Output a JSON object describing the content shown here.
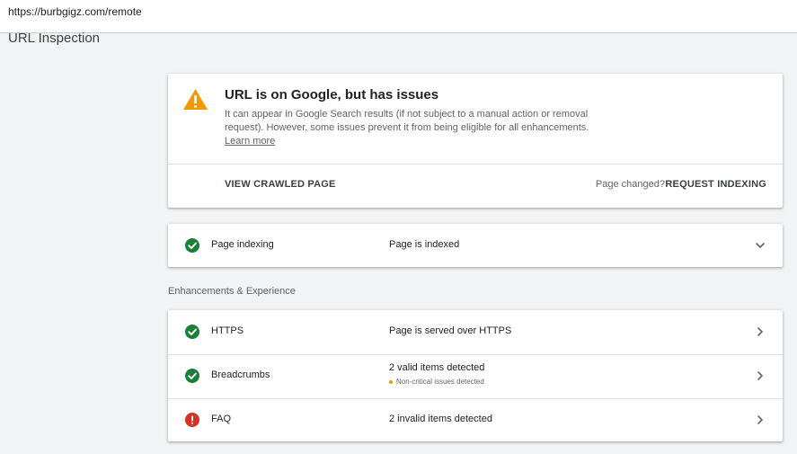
{
  "address_bar": {
    "url": "https://burbgigz.com/remote"
  },
  "page": {
    "title": "URL Inspection"
  },
  "verdict": {
    "title": "URL is on Google, but has issues",
    "description": "It can appear in Google Search results (if not subject to a manual action or removal request). However, some issues prevent it from being eligible for all enhancements.",
    "learn_more": "Learn more",
    "view_crawled_page": "VIEW CRAWLED PAGE",
    "page_changed": "Page changed?",
    "request_indexing": "REQUEST INDEXING",
    "icon": "warning-icon",
    "color": "#f29900"
  },
  "indexing": {
    "label": "Page indexing",
    "status": "Page is indexed",
    "icon": "check-circle-icon",
    "color": "#188038"
  },
  "enhancements": {
    "header": "Enhancements & Experience",
    "rows": [
      {
        "label": "HTTPS",
        "status": "Page is served over HTTPS",
        "sub": "",
        "icon": "check-circle-icon"
      },
      {
        "label": "Breadcrumbs",
        "status": "2 valid items detected",
        "sub": "Non-critical issues detected",
        "icon": "check-circle-icon"
      },
      {
        "label": "FAQ",
        "status": "2 invalid items detected",
        "sub": "",
        "icon": "error-circle-icon"
      }
    ],
    "colors": {
      "valid": "#188038",
      "error": "#d93025",
      "warning": "#f29900"
    }
  }
}
